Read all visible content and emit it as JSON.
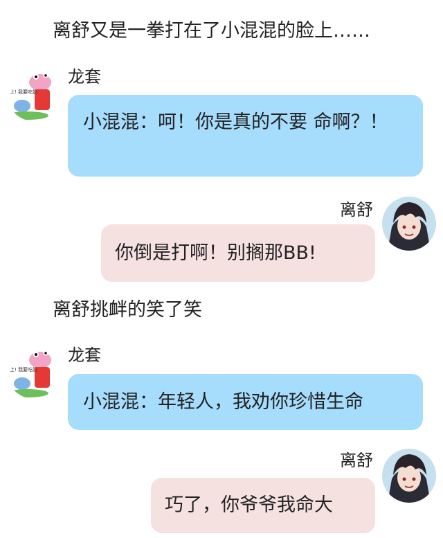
{
  "narration": [
    "离舒又是一拳打在了小混混的脸上……",
    "离舒挑衅的笑了笑"
  ],
  "messages": [
    {
      "sender": "龙套",
      "side": "left",
      "avatar": "peppa-pig-avatar",
      "text": "小混混：呵！你是真的不要 命啊？！"
    },
    {
      "sender": "离舒",
      "side": "right",
      "avatar": "anime-boy-avatar",
      "text": "你倒是打啊！别搁那BB!"
    },
    {
      "sender": "龙套",
      "side": "left",
      "avatar": "peppa-pig-avatar",
      "text": "小混混：年轻人，我劝你珍惜生命"
    },
    {
      "sender": "离舒",
      "side": "right",
      "avatar": "anime-boy-avatar",
      "text": "巧了，你爷爷我命大"
    }
  ],
  "avatar_caption": "上! 我要吃奶",
  "colors": {
    "left_bubble": "#a6dcfc",
    "right_bubble": "#f6e1e1",
    "text": "#222222",
    "background": "#ffffff"
  }
}
